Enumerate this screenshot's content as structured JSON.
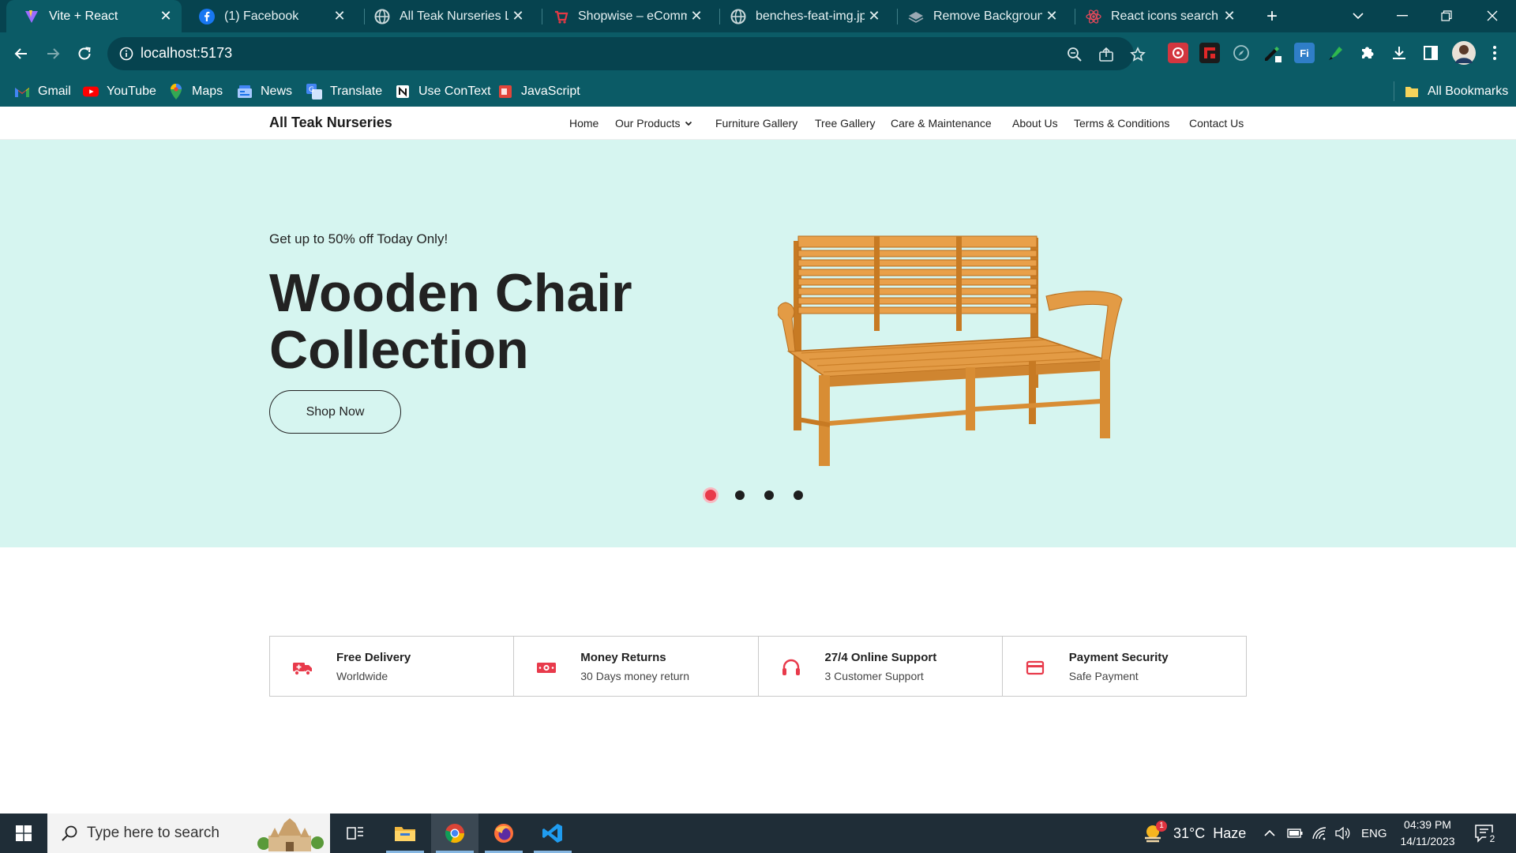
{
  "browser": {
    "tabs": [
      {
        "title": "Vite + React",
        "icon": "vite-icon",
        "active": true
      },
      {
        "title": "(1) Facebook",
        "icon": "facebook-icon",
        "active": false
      },
      {
        "title": "All Teak Nurseries Lin",
        "icon": "globe-icon",
        "active": false
      },
      {
        "title": "Shopwise – eComme",
        "icon": "shopwise-icon",
        "active": false
      },
      {
        "title": "benches-feat-img.jpg",
        "icon": "globe-icon",
        "active": false
      },
      {
        "title": "Remove Background",
        "icon": "layers-icon",
        "active": false
      },
      {
        "title": "React icons search re",
        "icon": "react-icon",
        "active": false
      }
    ],
    "url": "localhost:5173",
    "bookmarks": [
      {
        "label": "Gmail",
        "icon": "gmail-icon"
      },
      {
        "label": "YouTube",
        "icon": "youtube-icon"
      },
      {
        "label": "Maps",
        "icon": "maps-icon"
      },
      {
        "label": "News",
        "icon": "news-icon"
      },
      {
        "label": "Translate",
        "icon": "translate-icon"
      },
      {
        "label": "Use ConText",
        "icon": "notion-icon"
      },
      {
        "label": "JavaScript",
        "icon": "javascript-icon"
      }
    ],
    "all_bookmarks_label": "All Bookmarks"
  },
  "site": {
    "brand": "All Teak Nurseries",
    "nav": [
      {
        "label": "Home"
      },
      {
        "label": "Our Products",
        "has_dropdown": true
      },
      {
        "label": "Furniture Gallery"
      },
      {
        "label": "Tree Gallery"
      },
      {
        "label": "Care & Maintenance"
      },
      {
        "label": "About Us"
      },
      {
        "label": "Terms & Conditions"
      },
      {
        "label": "Contact Us"
      }
    ],
    "hero": {
      "tagline": "Get up to 50% off Today Only!",
      "headline": "Wooden Chair Collection",
      "button_label": "Shop Now",
      "slide_count": 4,
      "active_slide": 1
    },
    "features": [
      {
        "title": "Free Delivery",
        "subtitle": "Worldwide",
        "icon": "truck-icon"
      },
      {
        "title": "Money Returns",
        "subtitle": "30 Days money return",
        "icon": "money-icon"
      },
      {
        "title": "27/4 Online Support",
        "subtitle": "3 Customer Support",
        "icon": "headphones-icon"
      },
      {
        "title": "Payment Security",
        "subtitle": "Safe Payment",
        "icon": "credit-card-icon"
      }
    ],
    "colors": {
      "accent": "#e83a4b",
      "hero_bg": "#d6f5f0",
      "chrome_bar": "#0b5b66"
    }
  },
  "taskbar": {
    "search_placeholder": "Type here to search",
    "weather": "31°C  Haze",
    "weather_badge": "1",
    "language": "ENG",
    "time": "04:39 PM",
    "date": "14/11/2023",
    "notification_count": "2"
  }
}
